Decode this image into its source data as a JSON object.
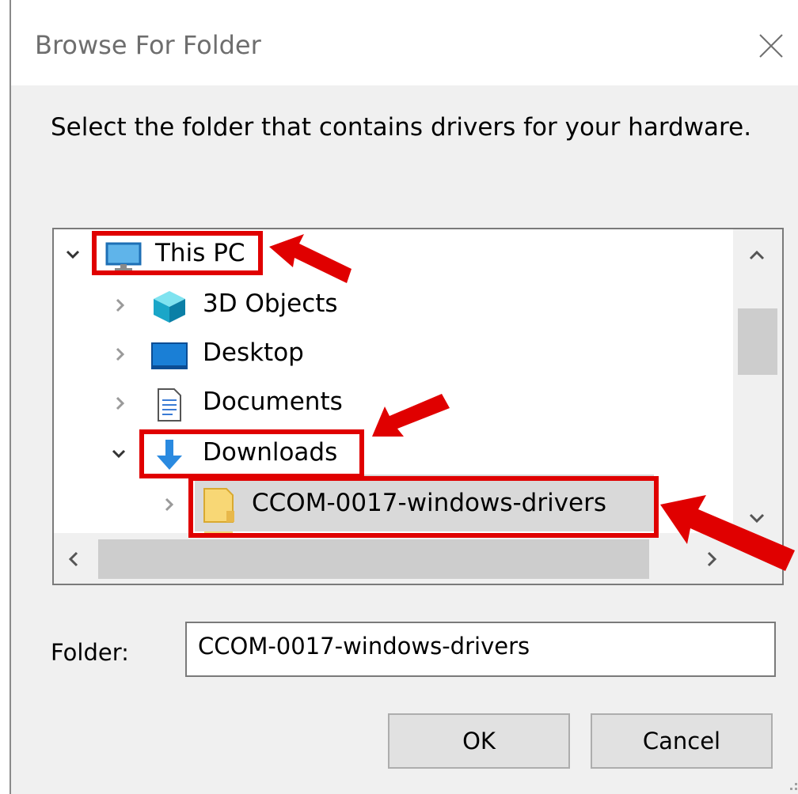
{
  "dialog": {
    "title": "Browse For Folder",
    "instruction": "Select the folder that contains drivers for your hardware."
  },
  "tree": {
    "items": [
      {
        "label": "This PC",
        "icon": "computer-icon",
        "expander": "expanded"
      },
      {
        "label": "3D Objects",
        "icon": "3d-objects-icon",
        "expander": "collapsed"
      },
      {
        "label": "Desktop",
        "icon": "desktop-icon",
        "expander": "collapsed"
      },
      {
        "label": "Documents",
        "icon": "documents-icon",
        "expander": "collapsed"
      },
      {
        "label": "Downloads",
        "icon": "downloads-icon",
        "expander": "expanded"
      },
      {
        "label": "CCOM-0017-windows-drivers",
        "icon": "folder-icon",
        "expander": "collapsed",
        "selected": true
      }
    ]
  },
  "folder": {
    "label": "Folder:",
    "value": "CCOM-0017-windows-drivers"
  },
  "buttons": {
    "ok": "OK",
    "cancel": "Cancel"
  },
  "colors": {
    "annotation": "#e00000",
    "selection": "#d9d9d9",
    "dialog_bg": "#f0f0f0"
  }
}
